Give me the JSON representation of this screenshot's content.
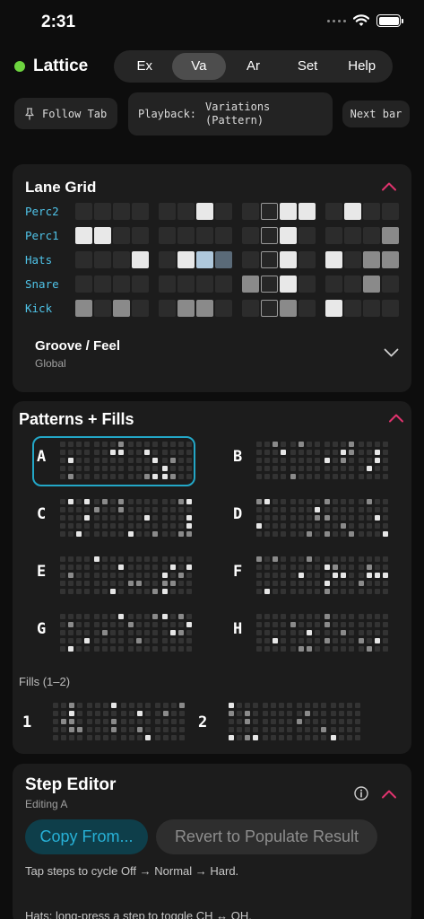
{
  "status": {
    "time": "2:31"
  },
  "header": {
    "app_title": "Lattice",
    "tabs": [
      {
        "label": "Ex",
        "active": false
      },
      {
        "label": "Va",
        "active": true
      },
      {
        "label": "Ar",
        "active": false
      },
      {
        "label": "Set",
        "active": false
      },
      {
        "label": "Help",
        "active": false
      }
    ]
  },
  "controls": {
    "follow_tab": "Follow Tab",
    "playback_label": "Playback:",
    "playback_value_1": "Variations",
    "playback_value_2": "(Pattern)",
    "next_bar": "Next bar"
  },
  "lane_grid": {
    "title": "Lane Grid",
    "lanes": [
      {
        "label": "Perc2",
        "cells": "0000 0010 0011 0100"
      },
      {
        "label": "Perc1",
        "cells": "2200 0000 0010 0003"
      },
      {
        "label": "Hats",
        "cells": "0002 0254 0010 2063"
      },
      {
        "label": "Snare",
        "cells": "0000 0000 3010 0030"
      },
      {
        "label": "Kick",
        "cells": "3030 0330 0030 2000"
      }
    ],
    "groove_title": "Groove / Feel",
    "groove_sub": "Global"
  },
  "patterns": {
    "title": "Patterns + Fills",
    "items": [
      {
        "letter": "A"
      },
      {
        "letter": "B"
      },
      {
        "letter": "C"
      },
      {
        "letter": "D"
      },
      {
        "letter": "E"
      },
      {
        "letter": "F"
      },
      {
        "letter": "G"
      },
      {
        "letter": "H"
      }
    ],
    "selected": "A",
    "fills_label": "Fills (1–2)",
    "fills": [
      {
        "label": "1"
      },
      {
        "label": "2"
      }
    ]
  },
  "step_editor": {
    "title": "Step Editor",
    "subtitle": "Editing A",
    "copy_button": "Copy From...",
    "revert_button": "Revert to Populate Result",
    "help_1": "Tap steps to cycle Off → Normal → Hard.",
    "help_2": "Hats: long-press a step to toggle CH ↔ OH."
  },
  "colors": {
    "accent_pink": "#e0336e",
    "accent_cyan": "#23a7c7",
    "lane_label": "#4fc3e8",
    "status_dot": "#6dd43f"
  }
}
